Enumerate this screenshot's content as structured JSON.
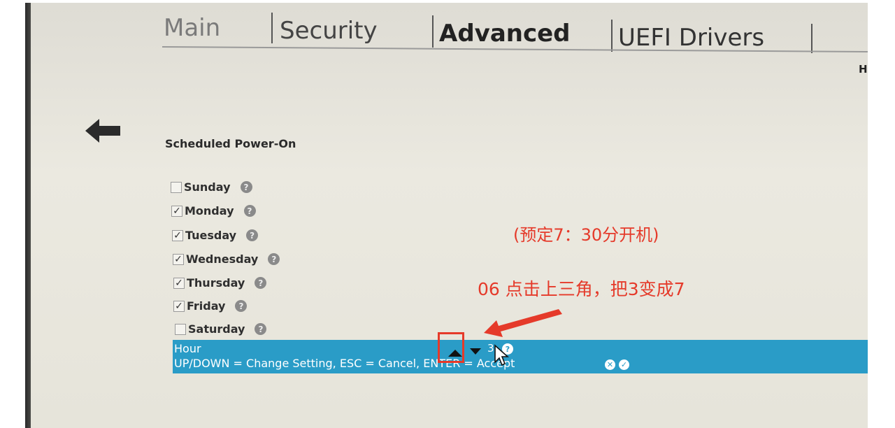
{
  "tabs": [
    {
      "label": "Main"
    },
    {
      "label": "Security"
    },
    {
      "label": "Advanced"
    },
    {
      "label": "UEFI Drivers"
    }
  ],
  "header_hint": "H",
  "section_title": "Scheduled Power-On",
  "days": [
    {
      "label": "Sunday",
      "checked": false
    },
    {
      "label": "Monday",
      "checked": true
    },
    {
      "label": "Tuesday",
      "checked": true
    },
    {
      "label": "Wednesday",
      "checked": true
    },
    {
      "label": "Thursday",
      "checked": true
    },
    {
      "label": "Friday",
      "checked": true
    },
    {
      "label": "Saturday",
      "checked": false
    }
  ],
  "hour_field": {
    "label": "Hour",
    "value": "3",
    "help_text": "UP/DOWN = Change Setting,  ESC = Cancel,  ENTER = Accept"
  },
  "annotations": {
    "schedule_note": "(预定7：30分开机)",
    "step_note": "06 点击上三角，把3变成7"
  },
  "colors": {
    "highlight_bar": "#2a9cc7",
    "annotation_red": "#e53a2a"
  },
  "icons": [
    "back-arrow-icon",
    "help-icon",
    "up-triangle-icon",
    "down-triangle-icon",
    "mouse-cursor-icon",
    "cancel-icon",
    "accept-icon"
  ]
}
